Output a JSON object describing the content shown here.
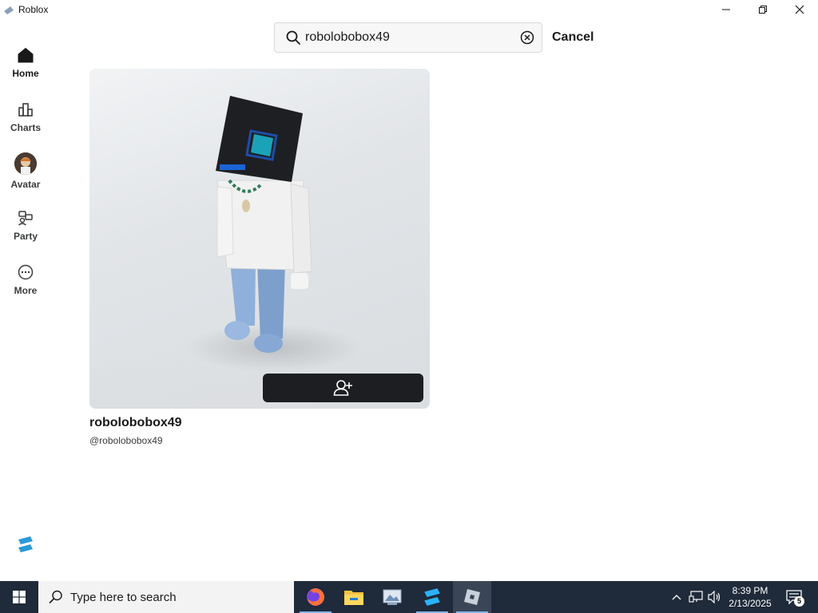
{
  "window": {
    "title": "Roblox",
    "icon": "roblox-app-icon"
  },
  "search": {
    "value": "robolobobox49",
    "placeholder": "",
    "cancel_label": "Cancel"
  },
  "sidebar": {
    "items": [
      {
        "label": "Home",
        "icon": "home-icon",
        "active": true
      },
      {
        "label": "Charts",
        "icon": "charts-icon"
      },
      {
        "label": "Avatar",
        "icon": "avatar-icon"
      },
      {
        "label": "Party",
        "icon": "party-icon"
      },
      {
        "label": "More",
        "icon": "more-icon"
      }
    ]
  },
  "result": {
    "display_name": "robolobobox49",
    "username": "@robolobobox49",
    "action": "add-friend-icon"
  },
  "taskbar": {
    "search_label": "Type here to search",
    "apps": [
      "firefox-icon",
      "file-explorer-icon",
      "photos-icon",
      "roblox-studio-icon",
      "roblox-icon"
    ],
    "time": "8:39 PM",
    "date": "2/13/2025",
    "notification_count": "5"
  },
  "colors": {
    "accent": "#1c1e22",
    "taskbar": "#1f2a3a",
    "running_indicator": "#7eb4ea"
  }
}
